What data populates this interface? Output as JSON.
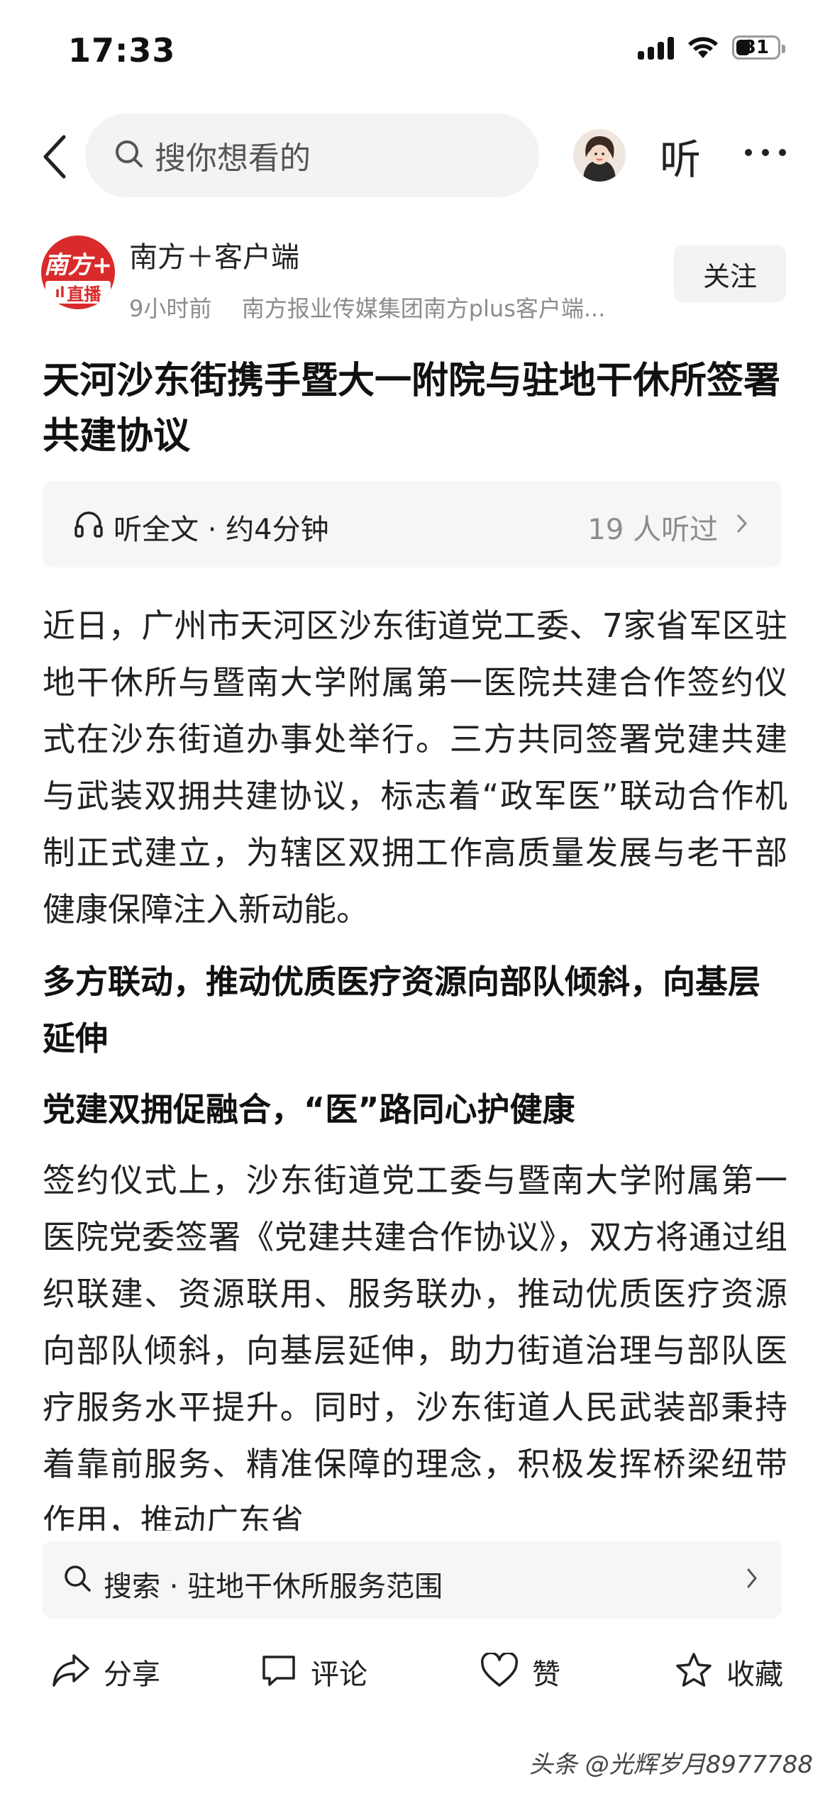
{
  "status_bar": {
    "time": "17:33",
    "battery_level": "31"
  },
  "nav": {
    "search_placeholder": "搜你想看的",
    "listen_label": "听"
  },
  "author": {
    "logo_text": "南方+",
    "logo_badge": "直播",
    "name": "南方＋客户端",
    "time_ago": "9小时前",
    "source": "南方报业传媒集团南方plus客户端...",
    "follow_label": "关注"
  },
  "article": {
    "title": "天河沙东街携手暨大一附院与驻地干休所签署共建协议",
    "listen_full": "听全文 · 约4分钟",
    "listen_count": "19 人听过",
    "paragraph_1": "近日，广州市天河区沙东街道党工委、7家省军区驻地干休所与暨南大学附属第一医院共建合作签约仪式在沙东街道办事处举行。三方共同签署党建共建与武装双拥共建协议，标志着“政军医”联动合作机制正式建立，为辖区双拥工作高质量发展与老干部健康保障注入新动能。",
    "heading_1": "多方联动，推动优质医疗资源向部队倾斜，向基层延伸",
    "heading_2": "党建双拥促融合，“医”路同心护健康",
    "paragraph_2": "签约仪式上，沙东街道党工委与暨南大学附属第一医院党委签署《党建共建合作协议》，双方将通过组织联建、资源联用、服务联办，推动优质医疗资源向部队倾斜，向基层延伸，助力街道治理与部队医疗服务水平提升。同时，沙东街道人民武装部秉持着靠前服务、精准保障的理念，积极发挥桥梁纽带作用，推动广东省"
  },
  "related_search": {
    "label": "搜索 · 驻地干休所服务范围"
  },
  "bottom_bar": {
    "share": "分享",
    "comment": "评论",
    "like": "赞",
    "favorite": "收藏"
  },
  "watermark": "头条 @光辉岁月8977788",
  "colors": {
    "logo_red": "#d92b2b",
    "muted_text": "#8c8c8c",
    "chip_bg": "#f3f3f3"
  }
}
